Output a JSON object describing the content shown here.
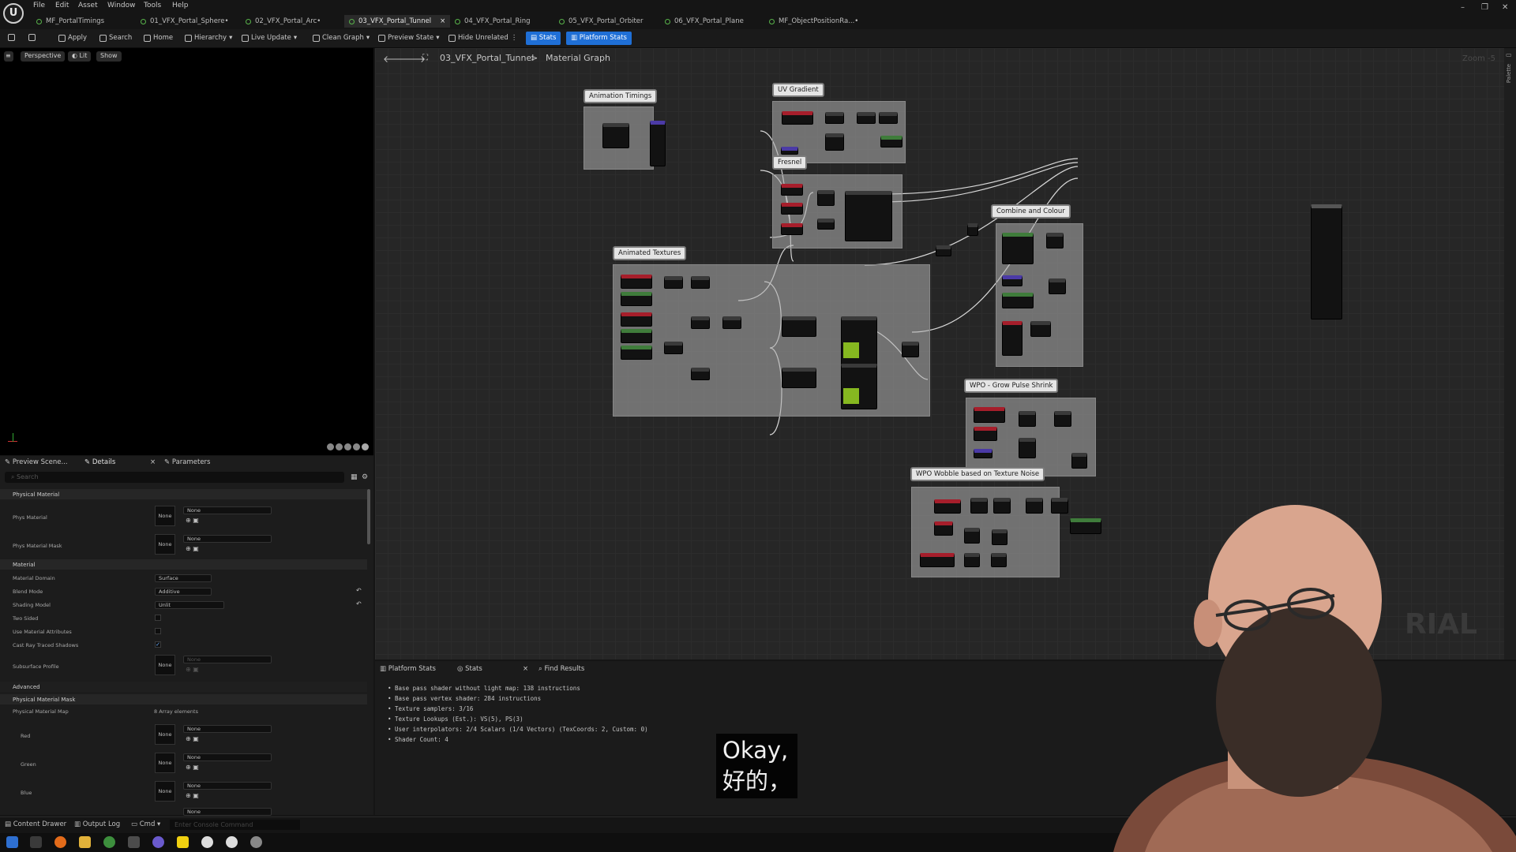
{
  "menu": [
    "File",
    "Edit",
    "Asset",
    "Window",
    "Tools",
    "Help"
  ],
  "tabs": [
    "MF_PortalTimings",
    "01_VFX_Portal_Sphere•",
    "02_VFX_Portal_Arc•",
    "03_VFX_Portal_Tunnel",
    "04_VFX_Portal_Ring",
    "05_VFX_Portal_Orbiter",
    "06_VFX_Portal_Plane",
    "MF_ObjectPositionRa...•"
  ],
  "toolbar": {
    "apply": "Apply",
    "search": "Search",
    "home": "Home",
    "hierarchy": "Hierarchy",
    "live_update": "Live Update",
    "clean_graph": "Clean Graph",
    "preview_state": "Preview State",
    "hide_unrelated": "Hide Unrelated",
    "stats": "Stats",
    "platform_stats": "Platform Stats"
  },
  "viewport": {
    "perspective": "Perspective",
    "lit": "Lit",
    "show": "Show"
  },
  "details": {
    "tabs": [
      "Preview Scene...",
      "Details",
      "Parameters"
    ],
    "search_placeholder": "Search",
    "sections": {
      "phys_material": "Physical Material",
      "material": "Material",
      "advanced": "Advanced",
      "phys_mask": "Physical Material Mask"
    },
    "props": {
      "phys_material": "Phys Material",
      "phys_material_mask": "Phys Material Mask",
      "material_domain": "Material Domain",
      "blend_mode": "Blend Mode",
      "shading_model": "Shading Model",
      "two_sided": "Two Sided",
      "use_material_attributes": "Use Material Attributes",
      "cast_ray_traced_shadows": "Cast Ray Traced Shadows",
      "subsurface_profile": "Subsurface Profile",
      "phys_material_map": "Physical Material Map",
      "red": "Red",
      "green": "Green",
      "blue": "Blue"
    },
    "values": {
      "none": "None",
      "surface": "Surface",
      "additive": "Additive",
      "unlit": "Unlit",
      "array": "8 Array elements"
    }
  },
  "graph": {
    "breadcrumb_asset": "03_VFX_Portal_Tunnel",
    "breadcrumb_sep": ">",
    "breadcrumb_graph": "Material Graph",
    "zoom": "Zoom -5",
    "palette": "Palette",
    "watermark": "RIAL",
    "comments": {
      "animation_timings": "Animation Timings",
      "uv_gradient": "UV Gradient",
      "fresnel": "Fresnel",
      "animated_textures": "Animated Textures",
      "combine_colour": "Combine and Colour",
      "wpo_grow": "WPO - Grow Pulse Shrink",
      "wpo_wobble": "WPO Wobble based on Texture Noise"
    }
  },
  "stats": {
    "tabs": [
      "Platform Stats",
      "Stats",
      "Find Results"
    ],
    "lines": [
      "• Base pass shader without light map: 138 instructions",
      "• Base pass vertex shader: 284 instructions",
      "• Texture samplers: 3/16",
      "• Texture Lookups (Est.): VS(5), PS(3)",
      "• User interpolators: 2/4 Scalars (1/4 Vectors) (TexCoords: 2, Custom: 0)",
      "• Shader Count: 4"
    ]
  },
  "bottombar": {
    "content_drawer": "Content Drawer",
    "output_log": "Output Log",
    "cmd": "Cmd",
    "console_placeholder": "Enter Console Command"
  },
  "subtitle": {
    "en": "Okay,",
    "zh": "好的，"
  }
}
